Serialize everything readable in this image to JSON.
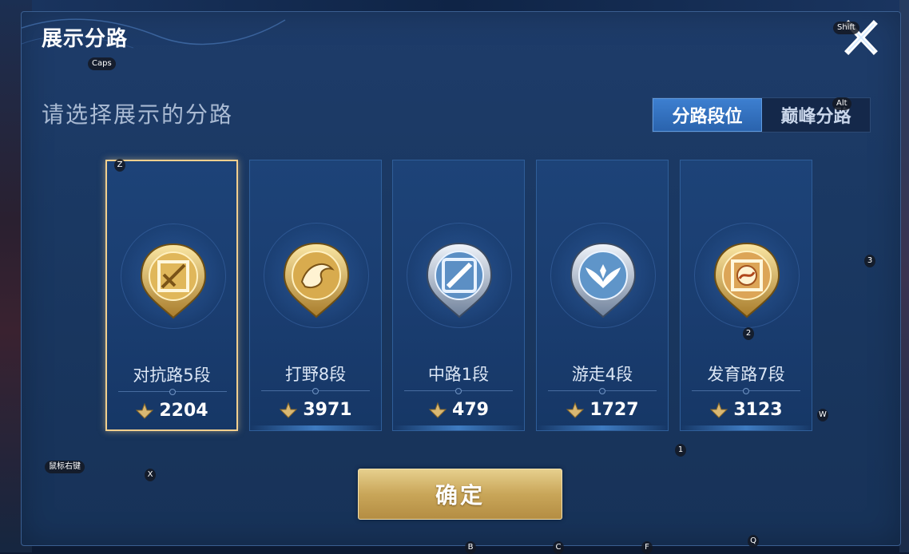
{
  "panel": {
    "title": "展示分路",
    "subtitle": "请选择展示的分路"
  },
  "tabs": [
    {
      "label": "分路段位",
      "active": true
    },
    {
      "label": "巅峰分路",
      "active": false
    }
  ],
  "cards": [
    {
      "rank": "对抗路5段",
      "score": "2204",
      "selected": true,
      "emblem": "sword-emblem-icon",
      "tier": "gold"
    },
    {
      "rank": "打野8段",
      "score": "3971",
      "selected": false,
      "emblem": "dragon-emblem-icon",
      "tier": "gold"
    },
    {
      "rank": "中路1段",
      "score": "479",
      "selected": false,
      "emblem": "staff-emblem-icon",
      "tier": "silver"
    },
    {
      "rank": "游走4段",
      "score": "1727",
      "selected": false,
      "emblem": "wings-emblem-icon",
      "tier": "silver"
    },
    {
      "rank": "发育路7段",
      "score": "3123",
      "selected": false,
      "emblem": "bow-emblem-icon",
      "tier": "gold"
    }
  ],
  "confirm_label": "确定",
  "key_hints": {
    "shift": "Shift",
    "caps": "Caps",
    "alt": "Alt",
    "z": "Z",
    "three": "3",
    "two": "2",
    "w": "W",
    "one": "1",
    "mouse_right": "鼠标右键",
    "x": "X",
    "b": "B",
    "c": "C",
    "f": "F",
    "q": "Q"
  },
  "colors": {
    "panel_bg": "#1a3862",
    "accent_blue": "#3d7fd0",
    "gold": "#c9a659",
    "selected_border": "#f1cf8e"
  }
}
